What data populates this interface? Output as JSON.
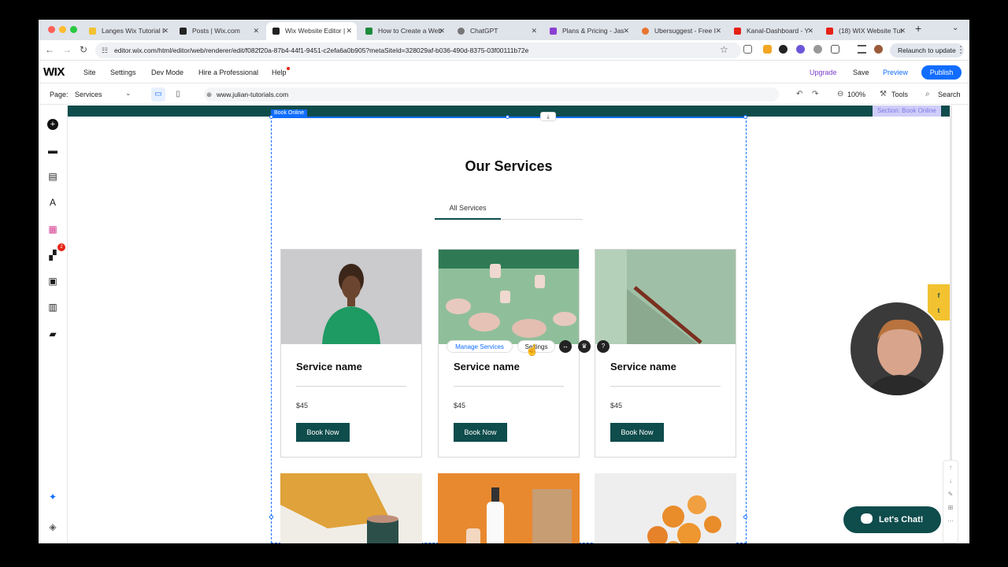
{
  "browser": {
    "tabs": [
      {
        "title": "Langes Wix Tutorial I",
        "icon": "wix-tutorial-favicon",
        "active": false
      },
      {
        "title": "Posts | Wix.com",
        "icon": "wix-favicon",
        "active": false
      },
      {
        "title": "Wix Website Editor |",
        "icon": "wix-favicon",
        "active": true
      },
      {
        "title": "How to Create a Web",
        "icon": "sheet-favicon",
        "active": false
      },
      {
        "title": "ChatGPT",
        "icon": "chatgpt-favicon",
        "active": false
      },
      {
        "title": "Plans & Pricing - Jas",
        "icon": "purple-favicon",
        "active": false
      },
      {
        "title": "Ubersuggest - Free I",
        "icon": "ubersuggest-favicon",
        "active": false
      },
      {
        "title": "Kanal-Dashboard - Y",
        "icon": "youtube-favicon",
        "active": false
      },
      {
        "title": "(18) WIX Website Tut",
        "icon": "youtube-favicon",
        "active": false
      }
    ],
    "url": "editor.wix.com/html/editor/web/renderer/edit/f082f20a-87b4-44f1-9451-c2efa6a0b905?metaSiteId=328029af-b036-490d-8375-03f00111b72e",
    "relaunch_label": "Relaunch to update"
  },
  "wix_bar": {
    "logo": "WIX",
    "menu": [
      "Site",
      "Settings",
      "Dev Mode",
      "Hire a Professional",
      "Help"
    ],
    "upgrade": "Upgrade",
    "save": "Save",
    "preview": "Preview",
    "publish": "Publish"
  },
  "page_bar": {
    "page_label": "Page:",
    "page_value": "Services",
    "domain": "www.julian-tutorials.com",
    "zoom": "100%",
    "tools": "Tools",
    "search": "Search"
  },
  "left_rail": {
    "icons": [
      "add-icon",
      "sections-icon",
      "pages-icon",
      "design-icon",
      "apps-icon",
      "business-apps-icon",
      "media-icon",
      "cms-icon",
      "portfolio-icon"
    ],
    "badge": "2"
  },
  "canvas": {
    "section_label": "Section: Book Online",
    "selection_tag": "Book Online",
    "title": "Our Services",
    "tab_all": "All Services",
    "toolbar": {
      "manage": "Manage Services",
      "settings": "Settings"
    },
    "cards": [
      {
        "name": "Service name",
        "price": "$45",
        "button": "Book Now"
      },
      {
        "name": "Service name",
        "price": "$45",
        "button": "Book Now"
      },
      {
        "name": "Service name",
        "price": "$45",
        "button": "Book Now"
      }
    ],
    "chat_button": "Let's Chat!"
  },
  "colors": {
    "accent": "#116dff",
    "brand_teal": "#0f4c4c",
    "section_purple": "#7f77e5",
    "upgrade_purple": "#7b3ec9"
  }
}
